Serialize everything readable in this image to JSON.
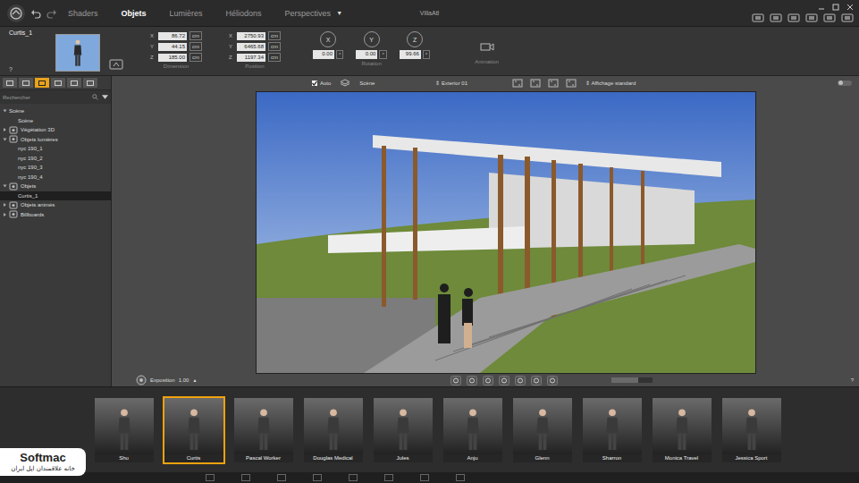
{
  "window": {
    "title": "VillaAtl"
  },
  "tabs": [
    {
      "label": "Shaders",
      "selected": false
    },
    {
      "label": "Objets",
      "selected": true
    },
    {
      "label": "Lumières",
      "selected": false
    },
    {
      "label": "Héliodons",
      "selected": false
    },
    {
      "label": "Perspectives",
      "selected": false
    }
  ],
  "tabs_menu_glyph": "▼",
  "inspector": {
    "object_name": "Curtis_1",
    "help": "?",
    "dimension": {
      "label": "Dimension",
      "fields": [
        {
          "axis": "X",
          "value": "86.72",
          "unit": "cm"
        },
        {
          "axis": "Y",
          "value": "44.15",
          "unit": "cm"
        },
        {
          "axis": "Z",
          "value": "185.00",
          "unit": "cm"
        }
      ]
    },
    "position": {
      "label": "Position",
      "fields": [
        {
          "axis": "X",
          "value": "2750.93",
          "unit": "cm"
        },
        {
          "axis": "Y",
          "value": "6465.68",
          "unit": "cm"
        },
        {
          "axis": "Z",
          "value": "1197.34",
          "unit": "cm"
        }
      ]
    },
    "rotation": {
      "label": "Rotation",
      "dials": [
        {
          "axis": "X",
          "value": "0.00",
          "unit": "°"
        },
        {
          "axis": "Y",
          "value": "0.00",
          "unit": "°"
        },
        {
          "axis": "Z",
          "value": "99.66",
          "unit": "°"
        }
      ]
    },
    "animation": {
      "label": "Animation"
    }
  },
  "sidebar": {
    "view_buttons": [
      {
        "selected": false
      },
      {
        "selected": false
      },
      {
        "selected": true
      },
      {
        "selected": false
      },
      {
        "selected": false
      },
      {
        "selected": false
      }
    ],
    "search_placeholder": "Rechercher",
    "tree": [
      {
        "label": "Scène",
        "kind": "root",
        "expanded": true,
        "selected": false
      },
      {
        "label": "Scène",
        "kind": "child",
        "expanded": false,
        "selected": false
      },
      {
        "label": "Végétation 3D",
        "kind": "category",
        "expanded": false,
        "selected": false
      },
      {
        "label": "Objets lumières",
        "kind": "category",
        "expanded": true,
        "selected": false
      },
      {
        "label": "nyc 190_1",
        "kind": "child",
        "expanded": false,
        "selected": false
      },
      {
        "label": "nyc 190_2",
        "kind": "child",
        "expanded": false,
        "selected": false
      },
      {
        "label": "nyc 190_3",
        "kind": "child",
        "expanded": false,
        "selected": false
      },
      {
        "label": "nyc 190_4",
        "kind": "child",
        "expanded": false,
        "selected": false
      },
      {
        "label": "Objets",
        "kind": "category",
        "expanded": true,
        "selected": false
      },
      {
        "label": "Curtis_1",
        "kind": "child",
        "expanded": false,
        "selected": true
      },
      {
        "label": "Objets animés",
        "kind": "category",
        "expanded": false,
        "selected": false
      },
      {
        "label": "Billboards",
        "kind": "category",
        "expanded": false,
        "selected": false
      }
    ]
  },
  "viewport": {
    "auto": {
      "label": "Auto",
      "checked": true
    },
    "scene": "Scène",
    "selector_glyph": "⇕",
    "perspective": "Exterior 01",
    "display": "Affichage standard",
    "exposure": {
      "label": "Exposition",
      "value": "1.00",
      "glyph": "▲"
    },
    "help": "?"
  },
  "catalog": [
    {
      "name": "Shu",
      "selected": false
    },
    {
      "name": "Curtis",
      "selected": true
    },
    {
      "name": "Pascal Worker",
      "selected": false
    },
    {
      "name": "Douglas Medical",
      "selected": false
    },
    {
      "name": "Jules",
      "selected": false
    },
    {
      "name": "Anju",
      "selected": false
    },
    {
      "name": "Glenn",
      "selected": false
    },
    {
      "name": "Sharron",
      "selected": false
    },
    {
      "name": "Monica Travel",
      "selected": false
    },
    {
      "name": "Jessica Sport",
      "selected": false
    }
  ],
  "watermark": {
    "brand": "Softmac",
    "tagline": "خانه علاقمندان اپل ایران"
  }
}
